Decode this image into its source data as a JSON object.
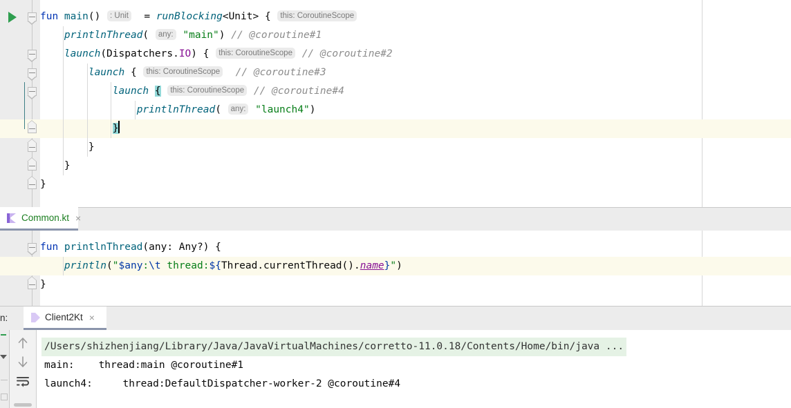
{
  "theme": {
    "keyword_color": "#0033b3",
    "function_color": "#00627a",
    "string_color": "#067d17",
    "comment_color": "#8c8c8c",
    "property_color": "#871094",
    "inlay_bg": "#ebebeb",
    "brace_match_bg": "#93d9d9",
    "caret_line_bg": "#fcfaeb",
    "console_command_bg": "#e5f2e5",
    "run_arrow_color": "#2e9e4f",
    "active_tab_underline": "#8a94ab"
  },
  "top_editor": {
    "name": "main-editor",
    "run_gutter_icon": "run-triangle-icon",
    "lines": [
      {
        "indent": 0,
        "fold": "start",
        "tokens": [
          {
            "t": "fun ",
            "c": "kw"
          },
          {
            "t": "main",
            "c": "fn-ni"
          },
          {
            "t": "()",
            "c": "plain"
          },
          {
            "t": " ",
            "c": "plain"
          },
          {
            "t": ": Unit",
            "c": "inlay"
          },
          {
            "t": "  = ",
            "c": "plain"
          },
          {
            "t": "runBlocking",
            "c": "fn"
          },
          {
            "t": "<Unit> { ",
            "c": "plain"
          },
          {
            "t": "this: CoroutineScope",
            "c": "inlay"
          }
        ]
      },
      {
        "indent": 1,
        "fold": "",
        "tokens": [
          {
            "t": "    ",
            "c": "plain"
          },
          {
            "t": "printlnThread",
            "c": "fn"
          },
          {
            "t": "( ",
            "c": "plain"
          },
          {
            "t": "any:",
            "c": "inlay"
          },
          {
            "t": " ",
            "c": "plain"
          },
          {
            "t": "\"main\"",
            "c": "str"
          },
          {
            "t": ") ",
            "c": "plain"
          },
          {
            "t": "// @coroutine#1",
            "c": "cmt"
          }
        ]
      },
      {
        "indent": 1,
        "fold": "start",
        "tokens": [
          {
            "t": "    ",
            "c": "plain"
          },
          {
            "t": "launch",
            "c": "fn"
          },
          {
            "t": "(",
            "c": "plain"
          },
          {
            "t": "Dispatchers.",
            "c": "plain"
          },
          {
            "t": "IO",
            "c": "prop"
          },
          {
            "t": ") { ",
            "c": "plain"
          },
          {
            "t": "this: CoroutineScope",
            "c": "inlay"
          },
          {
            "t": " ",
            "c": "plain"
          },
          {
            "t": "// @coroutine#2",
            "c": "cmt"
          }
        ]
      },
      {
        "indent": 2,
        "fold": "start",
        "tokens": [
          {
            "t": "        ",
            "c": "plain"
          },
          {
            "t": "launch",
            "c": "fn"
          },
          {
            "t": " { ",
            "c": "plain"
          },
          {
            "t": "this: CoroutineScope",
            "c": "inlay"
          },
          {
            "t": "  ",
            "c": "plain"
          },
          {
            "t": "// @coroutine#3",
            "c": "cmt"
          }
        ]
      },
      {
        "indent": 3,
        "fold": "start",
        "tokens": [
          {
            "t": "            ",
            "c": "plain"
          },
          {
            "t": "launch",
            "c": "fn"
          },
          {
            "t": " ",
            "c": "plain"
          },
          {
            "t": "{",
            "c": "brace-match"
          },
          {
            "t": " ",
            "c": "plain"
          },
          {
            "t": "this: CoroutineScope",
            "c": "inlay"
          },
          {
            "t": " ",
            "c": "plain"
          },
          {
            "t": "// @coroutine#4",
            "c": "cmt"
          }
        ]
      },
      {
        "indent": 4,
        "fold": "",
        "tokens": [
          {
            "t": "                ",
            "c": "plain"
          },
          {
            "t": "printlnThread",
            "c": "fn"
          },
          {
            "t": "( ",
            "c": "plain"
          },
          {
            "t": "any:",
            "c": "inlay"
          },
          {
            "t": " ",
            "c": "plain"
          },
          {
            "t": "\"launch4\"",
            "c": "str"
          },
          {
            "t": ")",
            "c": "plain"
          }
        ]
      },
      {
        "indent": 3,
        "fold": "end",
        "highlight": true,
        "caret": true,
        "tokens": [
          {
            "t": "            ",
            "c": "plain"
          },
          {
            "t": "}",
            "c": "brace-match"
          }
        ]
      },
      {
        "indent": 2,
        "fold": "end",
        "tokens": [
          {
            "t": "        ",
            "c": "plain"
          },
          {
            "t": "}",
            "c": "plain"
          }
        ]
      },
      {
        "indent": 1,
        "fold": "end",
        "tokens": [
          {
            "t": "    ",
            "c": "plain"
          },
          {
            "t": "}",
            "c": "plain"
          }
        ]
      },
      {
        "indent": 0,
        "fold": "end",
        "tokens": [
          {
            "t": "}",
            "c": "plain"
          }
        ]
      }
    ]
  },
  "middle_tabbar": {
    "tabs": [
      {
        "label": "Common.kt",
        "active": true,
        "icon": "kotlin-file-icon",
        "label_color": "#197d1e",
        "close": "×"
      }
    ]
  },
  "bottom_editor": {
    "name": "common-kt-editor",
    "lines": [
      {
        "indent": 0,
        "fold": "start",
        "tokens": [
          {
            "t": "fun ",
            "c": "kw"
          },
          {
            "t": "printlnThread",
            "c": "fn-ni"
          },
          {
            "t": "(any: Any?) {",
            "c": "plain"
          }
        ]
      },
      {
        "indent": 1,
        "fold": "",
        "highlight": true,
        "tokens": [
          {
            "t": "    ",
            "c": "plain"
          },
          {
            "t": "println",
            "c": "fn"
          },
          {
            "t": "(",
            "c": "plain"
          },
          {
            "t": "\"",
            "c": "str"
          },
          {
            "t": "$any",
            "c": "tmpl"
          },
          {
            "t": ":",
            "c": "str"
          },
          {
            "t": "\\t",
            "c": "esc"
          },
          {
            "t": " thread:",
            "c": "str"
          },
          {
            "t": "${",
            "c": "tmpl"
          },
          {
            "t": "Thread.currentThread().",
            "c": "plain"
          },
          {
            "t": "name",
            "c": "propu"
          },
          {
            "t": "}",
            "c": "tmpl"
          },
          {
            "t": "\"",
            "c": "str"
          },
          {
            "t": ")",
            "c": "plain"
          }
        ]
      },
      {
        "indent": 0,
        "fold": "end",
        "tokens": [
          {
            "t": "}",
            "c": "plain"
          }
        ]
      }
    ]
  },
  "run_panel": {
    "window_label": "n:",
    "tabs": [
      {
        "label": "Client2Kt",
        "active": true,
        "icon": "kotlin-run-icon",
        "close": "×"
      }
    ],
    "toolbar": [
      {
        "name": "scroll-up-button",
        "icon": "arrow-up-icon"
      },
      {
        "name": "scroll-down-button",
        "icon": "arrow-down-icon"
      },
      {
        "name": "soft-wrap-button",
        "icon": "soft-wrap-icon"
      }
    ],
    "console_lines": [
      {
        "text": "/Users/shizhenjiang/Library/Java/JavaVirtualMachines/corretto-11.0.18/Contents/Home/bin/java ...",
        "kind": "command"
      },
      {
        "text": "main:    thread:main @coroutine#1",
        "kind": "output"
      },
      {
        "text": "launch4:     thread:DefaultDispatcher-worker-2 @coroutine#4",
        "kind": "output"
      }
    ]
  }
}
